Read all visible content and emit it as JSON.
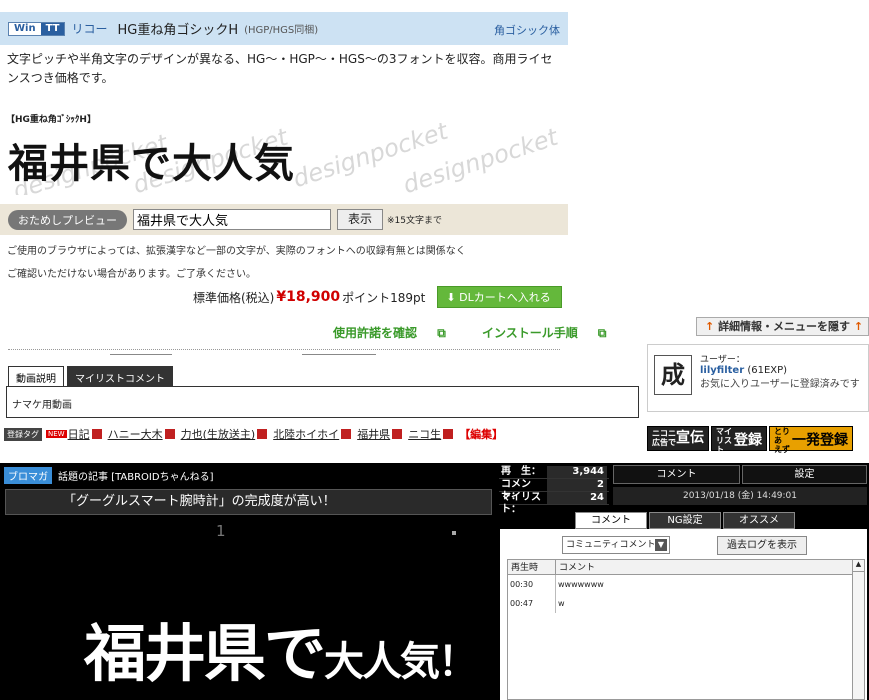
{
  "font": {
    "badge_win": "Win",
    "badge_tt": "TT",
    "maker": "リコー",
    "name": "HG重ね角ゴシックH",
    "variants": "(HGP/HGS同梱)",
    "category": "角ゴシック体",
    "description": "文字ピッチや半角文字のデザインが異なる、HG〜・HGP〜・HGS〜の3フォントを収容。商用ライセンスつき価格です。",
    "sample_label": "【HG重ね角ｺﾞｼｯｸH】",
    "sample_text": "福井県で大人気",
    "watermark": "designpocket"
  },
  "preview": {
    "button_label": "おためしプレビュー",
    "input_value": "福井県で大人気",
    "show_label": "表示",
    "max_note": "※15文字まで"
  },
  "notice": {
    "line1": "ご使用のブラウザによっては、拡張漢字など一部の文字が、実際のフォントへの収録有無とは関係なく",
    "line2": "ご確認いただけない場合があります。ご了承ください。"
  },
  "price": {
    "label": "標準価格(税込)",
    "value": "¥18,900",
    "points": "ポイント189pt",
    "cart_label": "DLカートへ入れる"
  },
  "links": {
    "license": "使用許諾を確認",
    "install": "インストール手順"
  },
  "side": {
    "detail_label": "詳細情報・メニューを隠す",
    "user_label": "ユーザー：",
    "user_name": "lilyfilter",
    "user_exp": "(61EXP)",
    "user_note": "お気に入りユーザーに登録済みです",
    "avatar_char": "成"
  },
  "tabs": {
    "description": "動画説明",
    "mylist_comment": "マイリストコメント"
  },
  "video_desc": "ナマケ用動画",
  "tags": {
    "label": "登録タグ",
    "new_badge": "NEW",
    "items": [
      "日記",
      "ハニー大木",
      "力也(生放送主)",
      "北陸ホイホイ",
      "福井県",
      "ニコ生"
    ],
    "edit": "【編集】"
  },
  "ads": {
    "nico_small": "ニコニ 広告で",
    "senden": "宣伝",
    "mylist_small": "マイ リスト",
    "toroku": "登録",
    "toriaezu_small": "とりあ えず",
    "ippatsu": "一発登録"
  },
  "player": {
    "blomaga": "ブロマガ",
    "article": "話題の記事 [TABROIDちゃんねる]",
    "headline": "「グーグルスマート腕時計」の完成度が高い！",
    "number": "1",
    "big_text_a": "福井県で",
    "big_text_b": "大人気！"
  },
  "stats": {
    "play_label": "再　生：",
    "play_value": "3,944",
    "comment_label": "コメント：",
    "comment_value": "2",
    "mylist_label": "マイリスト：",
    "mylist_value": "24",
    "date": "2013/01/18 (金) 14:49:01"
  },
  "panel": {
    "tab_comment": "コメント",
    "tab_settings": "設定",
    "ctab_comment": "コメント",
    "ctab_ng": "NG設定",
    "ctab_recommend": "オススメ",
    "select_value": "コミュニティコメント",
    "past_log": "過去ログを表示",
    "col_time": "再生時",
    "col_comment": "コメント",
    "rows": [
      {
        "time": "00:30",
        "text": "wwwwwww"
      },
      {
        "time": "00:47",
        "text": "w"
      }
    ]
  }
}
